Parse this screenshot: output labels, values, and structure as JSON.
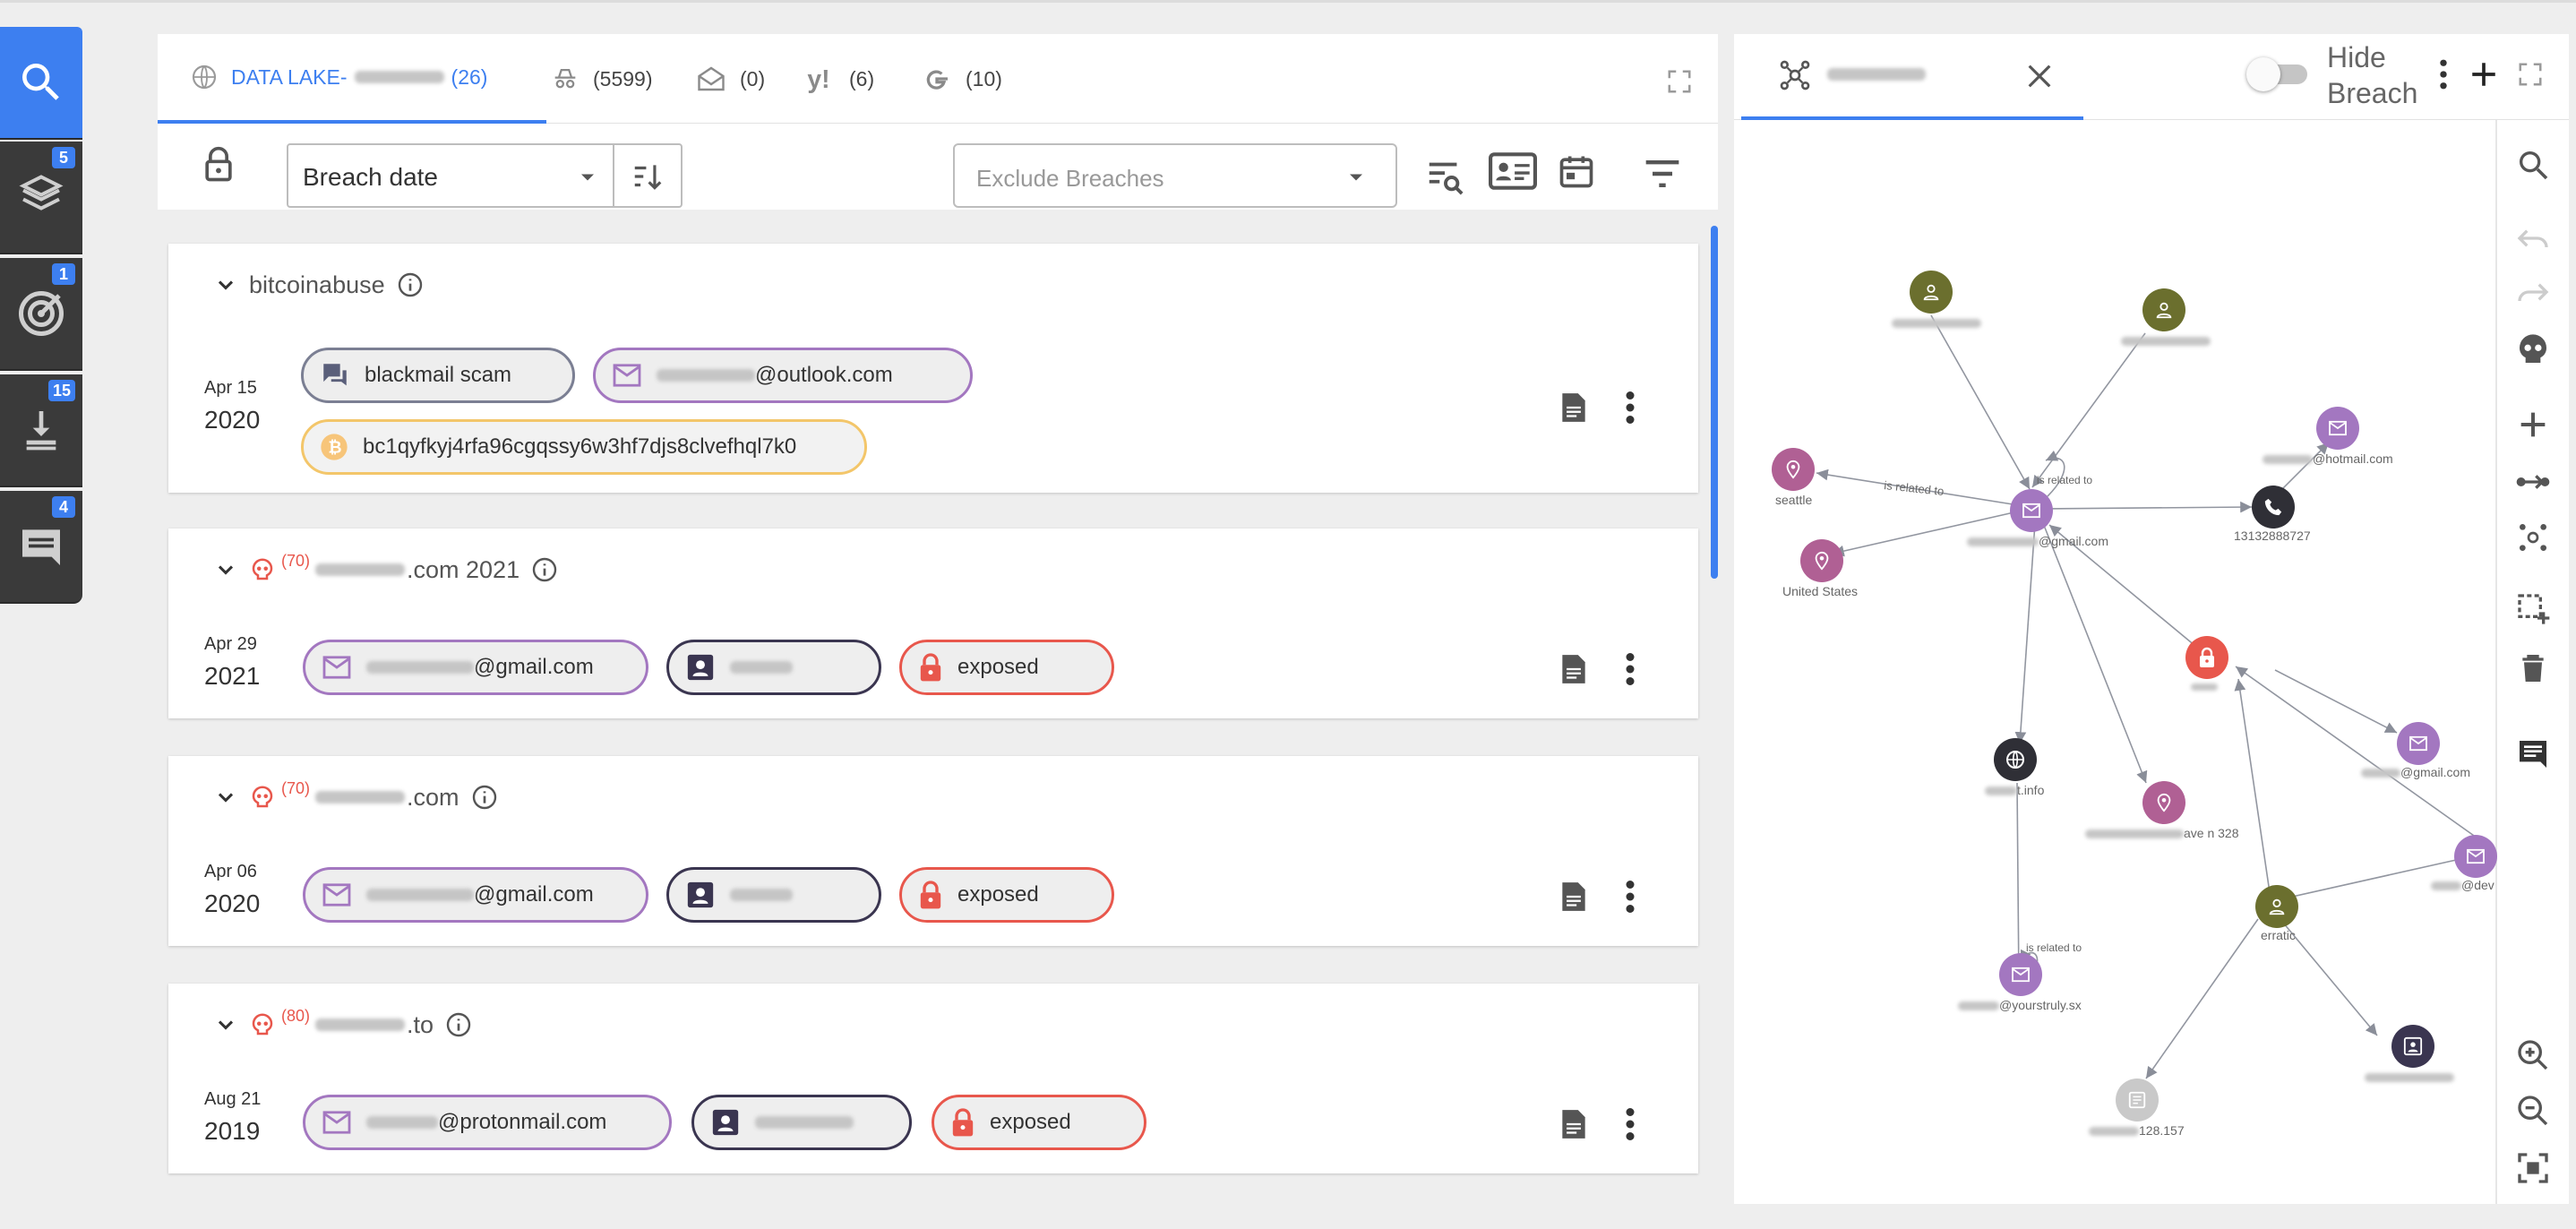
{
  "colors": {
    "accent": "#3d7ff0",
    "nav_bg": "#3a3a3a",
    "email_border": "#a377c0",
    "person_border": "#3a3550",
    "exposed_border": "#e8574c",
    "btc_border": "#f3c66a",
    "danger": "#e8574c"
  },
  "nav": {
    "items": [
      {
        "icon": "search-icon",
        "badge": ""
      },
      {
        "icon": "cube-icon",
        "badge": "5"
      },
      {
        "icon": "radar-icon",
        "badge": "1"
      },
      {
        "icon": "download-icon",
        "badge": "15"
      },
      {
        "icon": "comment-icon",
        "badge": "4"
      }
    ]
  },
  "tabs": [
    {
      "label": "DATA LAKE-",
      "count": "(26)",
      "icon": "globe-icon"
    },
    {
      "label": "",
      "count": "(5599)",
      "icon": "spy-icon"
    },
    {
      "label": "",
      "count": "(0)",
      "icon": "mail-open-icon"
    },
    {
      "label": "",
      "count": "(6)",
      "icon": "yahoo-icon"
    },
    {
      "label": "",
      "count": "(10)",
      "icon": "google-icon"
    }
  ],
  "toolbar": {
    "sort_value": "Breach date",
    "exclude_placeholder": "Exclude Breaches"
  },
  "cards": [
    {
      "source": "bitcoinabuse",
      "score": "",
      "date_md": "Apr 15",
      "date_year": "2020",
      "chips": [
        {
          "kind": "scam",
          "text": "blackmail scam"
        },
        {
          "kind": "email",
          "text": "@outlook.com"
        },
        {
          "kind": "btc",
          "text": "bc1qyfkyj4rfa96cgqssy6w3hf7djs8clvefhql7k0"
        }
      ]
    },
    {
      "source": ".com 2021",
      "score": "(70)",
      "date_md": "Apr 29",
      "date_year": "2021",
      "chips": [
        {
          "kind": "email",
          "text": "@gmail.com"
        },
        {
          "kind": "person",
          "text": ""
        },
        {
          "kind": "exposed",
          "text": "exposed"
        }
      ]
    },
    {
      "source": ".com",
      "score": "(70)",
      "date_md": "Apr 06",
      "date_year": "2020",
      "chips": [
        {
          "kind": "email",
          "text": "@gmail.com"
        },
        {
          "kind": "person",
          "text": ""
        },
        {
          "kind": "exposed",
          "text": "exposed"
        }
      ]
    },
    {
      "source": ".to",
      "score": "(80)",
      "date_md": "Aug 21",
      "date_year": "2019",
      "chips": [
        {
          "kind": "email",
          "text": "@protonmail.com"
        },
        {
          "kind": "person",
          "text": ""
        },
        {
          "kind": "exposed",
          "text": "exposed"
        }
      ]
    }
  ],
  "graph_panel": {
    "tab_label": "",
    "hide_breach_label_line1": "Hide",
    "hide_breach_label_line2": "Breach",
    "hide_breach_on": false
  },
  "graph": {
    "edge_labels": [
      "is related to",
      "is related to",
      "is related to"
    ],
    "node_labels": {
      "seattle": "seattle",
      "united_states": "United States",
      "gmail_main": "@gmail.com",
      "hotmail": "@hotmail.com",
      "phone": "13132888727",
      "info": "t.info",
      "address": "ave n 328",
      "gmail2": "@gmail.com",
      "dev": "@dev",
      "erratic": "erratic",
      "yourstruly": "@yourstruly.sx",
      "ip": "128.157"
    }
  }
}
